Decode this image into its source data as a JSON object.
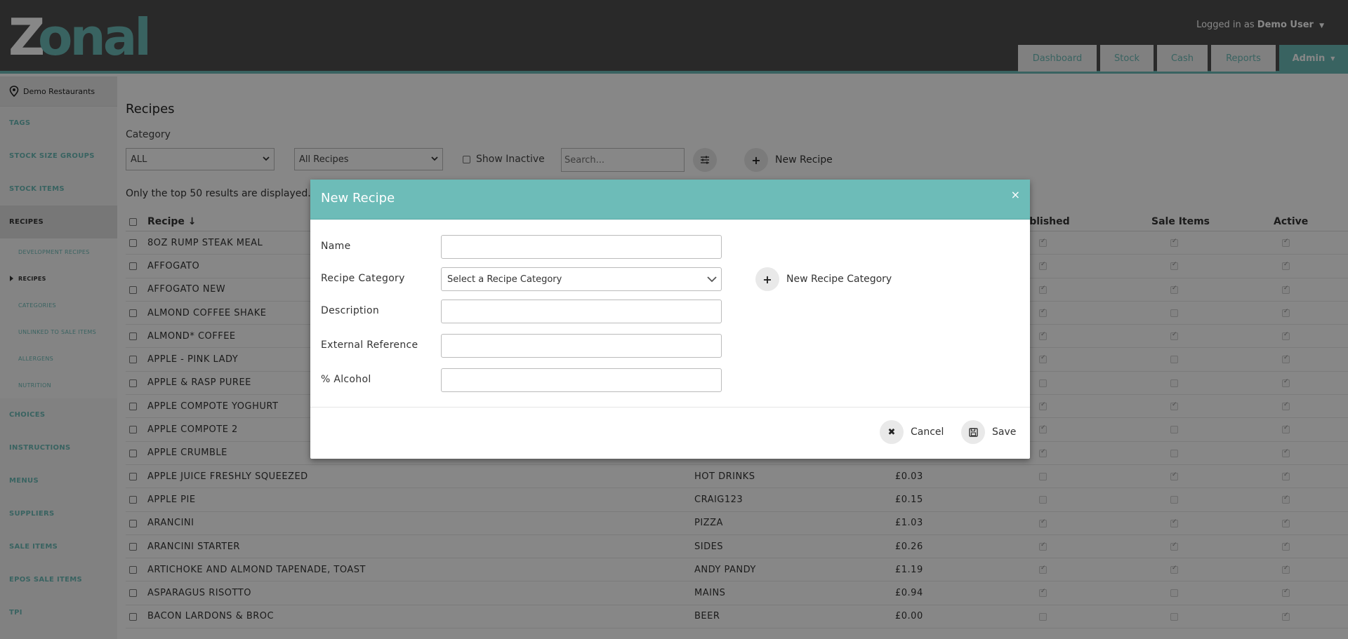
{
  "header": {
    "logo_text": "Zonal",
    "user_prefix": "Logged in as",
    "user_name": "Demo User",
    "nav": [
      "Dashboard",
      "Stock",
      "Cash",
      "Reports",
      "Admin"
    ],
    "accent": "#6dbcb8"
  },
  "sidebar": {
    "location": "Demo Restaurants",
    "items": [
      {
        "label": "TAGS",
        "type": "main"
      },
      {
        "label": "STOCK SIZE GROUPS",
        "type": "main"
      },
      {
        "label": "STOCK ITEMS",
        "type": "main"
      },
      {
        "label": "RECIPES",
        "type": "main",
        "active": true
      },
      {
        "label": "DEVELOPMENT RECIPES",
        "type": "sub"
      },
      {
        "label": "RECIPES",
        "type": "sub",
        "active": true
      },
      {
        "label": "CATEGORIES",
        "type": "sub"
      },
      {
        "label": "UNLINKED TO SALE ITEMS",
        "type": "sub"
      },
      {
        "label": "ALLERGENS",
        "type": "sub"
      },
      {
        "label": "NUTRITION",
        "type": "sub"
      },
      {
        "label": "CHOICES",
        "type": "main"
      },
      {
        "label": "INSTRUCTIONS",
        "type": "main"
      },
      {
        "label": "MENUS",
        "type": "main"
      },
      {
        "label": "SUPPLIERS",
        "type": "main"
      },
      {
        "label": "SALE ITEMS",
        "type": "main"
      },
      {
        "label": "EPOS SALE ITEMS",
        "type": "main"
      },
      {
        "label": "TPI",
        "type": "main"
      }
    ]
  },
  "main": {
    "title": "Recipes",
    "category_label": "Category",
    "category_value": "ALL",
    "recipe_filter_value": "All Recipes",
    "show_inactive_label": "Show Inactive",
    "search_placeholder": "Search...",
    "new_recipe_label": "New Recipe",
    "results_note": "Only the top 50 results are displayed.",
    "columns": {
      "recipe": "Recipe",
      "published": "Published",
      "sale_items": "Sale Items",
      "active": "Active"
    },
    "rows": [
      {
        "name": "8OZ RUMP STEAK MEAL",
        "category": "",
        "cost": "",
        "published": true,
        "sale": true,
        "active": true
      },
      {
        "name": "AFFOGATO",
        "category": "",
        "cost": "",
        "published": true,
        "sale": true,
        "active": true
      },
      {
        "name": "AFFOGATO NEW",
        "category": "",
        "cost": "",
        "published": true,
        "sale": true,
        "active": true
      },
      {
        "name": "ALMOND COFFEE SHAKE",
        "category": "",
        "cost": "",
        "published": true,
        "sale": false,
        "active": true
      },
      {
        "name": "ALMOND* COFFEE",
        "category": "",
        "cost": "",
        "published": true,
        "sale": true,
        "active": true
      },
      {
        "name": "APPLE - PINK LADY",
        "category": "",
        "cost": "",
        "published": true,
        "sale": false,
        "active": true
      },
      {
        "name": "APPLE & RASP PUREE",
        "category": "",
        "cost": "",
        "published": false,
        "sale": false,
        "active": true
      },
      {
        "name": "APPLE COMPOTE YOGHURT",
        "category": "",
        "cost": "",
        "published": true,
        "sale": true,
        "active": true
      },
      {
        "name": "APPLE COMPOTE 2",
        "category": "",
        "cost": "",
        "published": true,
        "sale": false,
        "active": true
      },
      {
        "name": "APPLE CRUMBLE",
        "category": "",
        "cost": "",
        "published": true,
        "sale": false,
        "active": true
      },
      {
        "name": "APPLE JUICE FRESHLY SQUEEZED",
        "category": "HOT DRINKS",
        "cost": "£0.03",
        "published": false,
        "sale": true,
        "active": true
      },
      {
        "name": "APPLE PIE",
        "category": "CRAIG123",
        "cost": "£0.15",
        "published": false,
        "sale": false,
        "active": true
      },
      {
        "name": "ARANCINI",
        "category": "PIZZA",
        "cost": "£1.03",
        "published": true,
        "sale": true,
        "active": true
      },
      {
        "name": "ARANCINI STARTER",
        "category": "SIDES",
        "cost": "£0.26",
        "published": true,
        "sale": true,
        "active": true
      },
      {
        "name": "ARTICHOKE AND ALMOND TAPENADE, TOAST",
        "category": "ANDY PANDY",
        "cost": "£1.19",
        "published": true,
        "sale": true,
        "active": true
      },
      {
        "name": "ASPARAGUS RISOTTO",
        "category": "MAINS",
        "cost": "£0.94",
        "published": true,
        "sale": false,
        "active": true
      },
      {
        "name": "BACON LARDONS & BROC",
        "category": "BEER",
        "cost": "£0.00",
        "published": false,
        "sale": false,
        "active": true
      }
    ]
  },
  "modal": {
    "title": "New Recipe",
    "close": "×",
    "name_label": "Name",
    "name_value": "",
    "category_label": "Recipe Category",
    "category_placeholder": "Select a Recipe Category",
    "new_category_label": "New Recipe Category",
    "description_label": "Description",
    "external_ref_label": "External Reference",
    "alcohol_label": "% Alcohol",
    "cancel_label": "Cancel",
    "save_label": "Save"
  }
}
